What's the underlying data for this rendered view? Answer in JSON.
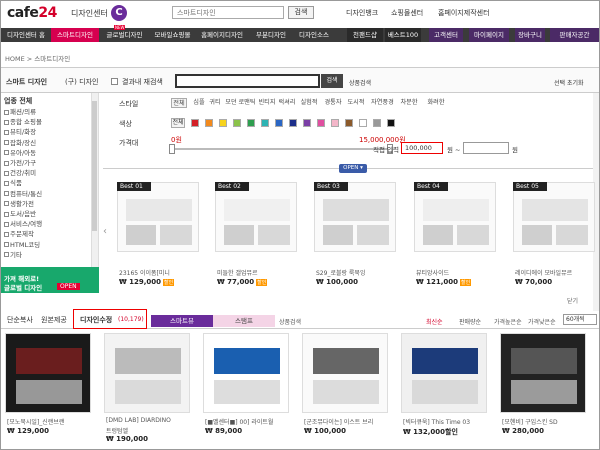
{
  "header": {
    "logo": "cafe24",
    "logo_sub": "디자인센터",
    "logo_mark": "C",
    "search_placeholder": "스마트디자인",
    "search_button": "검색",
    "links": [
      "디자인뱅크",
      "쇼핑몰센터",
      "홈페이지제작센터"
    ]
  },
  "nav": {
    "items": [
      "디자인센터 홈",
      "스마트디자인",
      "글로벌디자인",
      "모바일쇼핑몰",
      "홈페이지디자인",
      "부분디자인",
      "디자인소스",
      "천팬드샵",
      "베스트100",
      "고객센터",
      "마이페이지",
      "장바구니",
      "판매자공간"
    ],
    "new_badge": "NEW"
  },
  "breadcrumb": "HOME > 스마트디자인",
  "filter": {
    "tab1": "스마트 디자인",
    "tab2": "(구) 디자인",
    "checkbox_label": "결과내 재검색",
    "search_value": "",
    "search_button": "검색",
    "detail_search": "상품검색",
    "select_reset": "선택 초기화",
    "style_label": "스타일",
    "styles": [
      "전체",
      "심플",
      "귀티",
      "모던",
      "로맨틱",
      "빈티지",
      "럭셔리",
      "실험적",
      "경통자",
      "도시적",
      "자연풍경",
      "차분한",
      "화려한"
    ],
    "color_label": "색상",
    "color_all": "전체",
    "colors": [
      "#d32027",
      "#f28a1d",
      "#f7d31d",
      "#8bc34a",
      "#2e9e4f",
      "#2db3b3",
      "#2a66c4",
      "#1d2e8a",
      "#7b3fa6",
      "#e04fa0",
      "#f4b6c9",
      "#8b5a2b",
      "#ffffff",
      "#999999",
      "#111111"
    ],
    "price_label": "가격대",
    "price_min": "0원",
    "price_max": "15,000,000원",
    "direct_label": "직접 입력",
    "direct_from": "100,000",
    "unit1": "원 ~",
    "unit2": "원",
    "open_button": "OPEN ▾"
  },
  "categories": {
    "title": "업종 전체",
    "items": [
      "패션/의류",
      "종합 쇼핑몰",
      "뷰티/화장",
      "잡화/장신",
      "유아/아동",
      "가전/가구",
      "건강/취미",
      "식품",
      "컴퓨터/통신",
      "생활가전",
      "도서/음반",
      "서비스/여행",
      "주문제작",
      "HTML코딩",
      "기타"
    ]
  },
  "banner": {
    "line1": "가져 해외로!",
    "line2": "글로벌 디자인",
    "open": "OPEN"
  },
  "best": [
    {
      "badge": "Best 01",
      "name": "23165 이이폼[미니",
      "price": "₩ 129,000",
      "tag": "할인"
    },
    {
      "badge": "Best 02",
      "name": "미들한 갤업뮤르",
      "price": "₩ 77,000",
      "tag": "할인"
    },
    {
      "badge": "Best 03",
      "name": "S29_로블랑 룩북잉",
      "price": "₩ 100,000",
      "tag": ""
    },
    {
      "badge": "Best 04",
      "name": "뷰티앙사이드",
      "price": "₩ 121,000",
      "tag": "할인"
    },
    {
      "badge": "Best 05",
      "name": "레이디에이 모바일뮤르",
      "price": "₩ 70,000",
      "tag": ""
    }
  ],
  "close_link": "닫기",
  "tabs": {
    "t1": "단순복사",
    "t2": "원본제공",
    "active": "디자인수정",
    "active_count": "(10,179)",
    "purple": "스마트뷰",
    "pink": "스탬프",
    "small": "상품검색",
    "sort": [
      "최신순",
      "판매량순",
      "가격높은순",
      "가격낮은순"
    ],
    "per_page": "60개씩"
  },
  "products": [
    {
      "name": "[모노북시일]_신랜브랜",
      "name2": "",
      "price": "₩ 129,000",
      "tag": ""
    },
    {
      "name": "[DMD LAB] DIARDINO",
      "name2": "트렁텀엘",
      "price": "₩ 190,000",
      "tag": ""
    },
    {
      "name": "[■벨센터■] 00] 라이트월",
      "name2": "",
      "price": "₩ 89,000",
      "tag": ""
    },
    {
      "name": "[군조뮤다이는] 이스트 브리",
      "name2": "",
      "price": "₩ 100,000",
      "tag": ""
    },
    {
      "name": "[빅터큐욱] This Time 03",
      "name2": "",
      "price": "₩ 132,000",
      "tag": "할인"
    },
    {
      "name": "[모헨비] 구입스킨 SD",
      "name2": "",
      "price": "₩ 280,000",
      "tag": ""
    }
  ]
}
